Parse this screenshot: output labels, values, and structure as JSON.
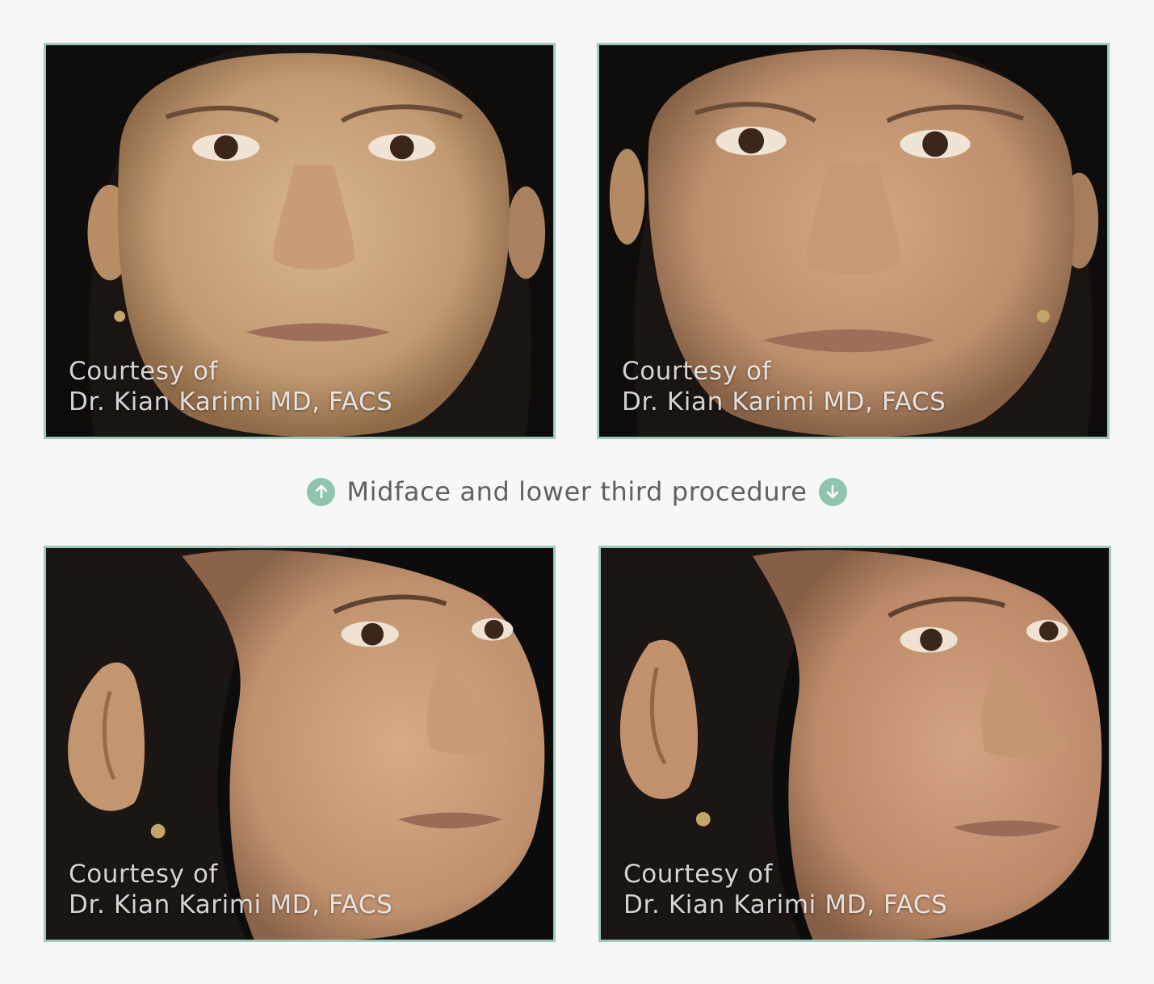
{
  "photos": [
    {
      "view": "front-before",
      "caption_line1": "Courtesy of",
      "caption_line2": "Dr. Kian Karimi MD, FACS"
    },
    {
      "view": "front-after",
      "caption_line1": "Courtesy of",
      "caption_line2": "Dr. Kian Karimi MD, FACS"
    },
    {
      "view": "oblique-before",
      "caption_line1": "Courtesy of",
      "caption_line2": "Dr. Kian Karimi MD, FACS"
    },
    {
      "view": "oblique-after",
      "caption_line1": "Courtesy of",
      "caption_line2": "Dr. Kian Karimi MD, FACS"
    }
  ],
  "procedure": {
    "label": "Midface and lower third procedure",
    "icon_up": "arrow-up-icon",
    "icon_down": "arrow-down-icon"
  },
  "colors": {
    "accent": "#8fc4ad",
    "frame_border": "#9ec8b7",
    "background": "#f7f7f7",
    "label_text": "#5d6160"
  }
}
